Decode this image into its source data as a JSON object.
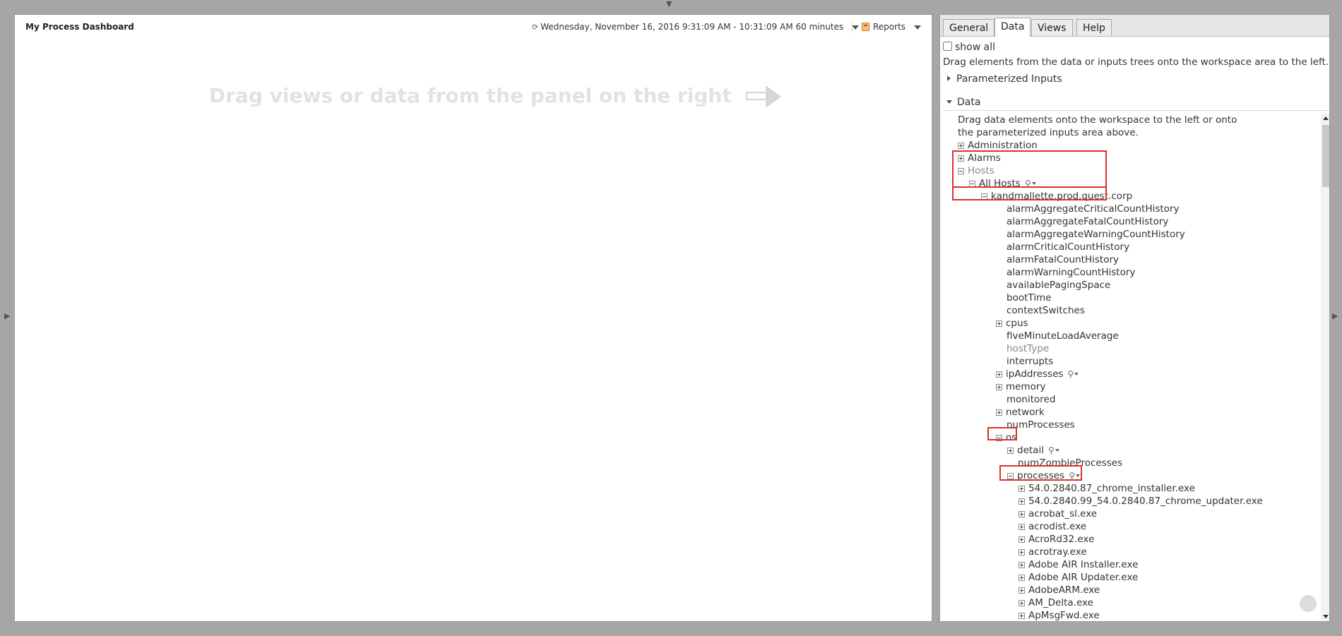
{
  "workspace": {
    "title": "My Process Dashboard",
    "time_range": "Wednesday, November 16, 2016 9:31:09 AM - 10:31:09 AM 60 minutes",
    "reports_label": "Reports",
    "hint": "Drag views or data from the panel on the right"
  },
  "panel": {
    "tabs": [
      "General",
      "Data",
      "Views",
      "Help"
    ],
    "active_tab": "Data",
    "show_all_label": "show all",
    "instruction": "Drag elements from the data or inputs trees onto the workspace area to the left.",
    "parameterized_inputs_label": "Parameterized Inputs",
    "data_section_label": "Data",
    "tree_description": "Drag data elements onto the workspace to the left or onto the parameterized inputs area above.",
    "tree": {
      "administration": "Administration",
      "alarms": "Alarms",
      "hosts": "Hosts",
      "all_hosts": "All Hosts",
      "host": "kandmallette.prod.quest.corp",
      "host_items": [
        "alarmAggregateCriticalCountHistory",
        "alarmAggregateFatalCountHistory",
        "alarmAggregateWarningCountHistory",
        "alarmCriticalCountHistory",
        "alarmFatalCountHistory",
        "alarmWarningCountHistory",
        "availablePagingSpace",
        "bootTime",
        "contextSwitches",
        "cpus",
        "fiveMinuteLoadAverage",
        "hostType",
        "interrupts",
        "ipAddresses",
        "memory",
        "monitored",
        "network",
        "numProcesses",
        "os"
      ],
      "os_items": [
        "detail",
        "numZombieProcesses",
        "processes"
      ],
      "processes": [
        "54.0.2840.87_chrome_installer.exe",
        "54.0.2840.99_54.0.2840.87_chrome_updater.exe",
        "acrobat_sl.exe",
        "acrodist.exe",
        "AcroRd32.exe",
        "acrotray.exe",
        "Adobe AIR Installer.exe",
        "Adobe AIR Updater.exe",
        "AdobeARM.exe",
        "AM_Delta.exe",
        "ApMsgFwd.exe"
      ]
    }
  },
  "colors": {
    "background": "#a6a6a6",
    "highlight": "#d9312c"
  }
}
